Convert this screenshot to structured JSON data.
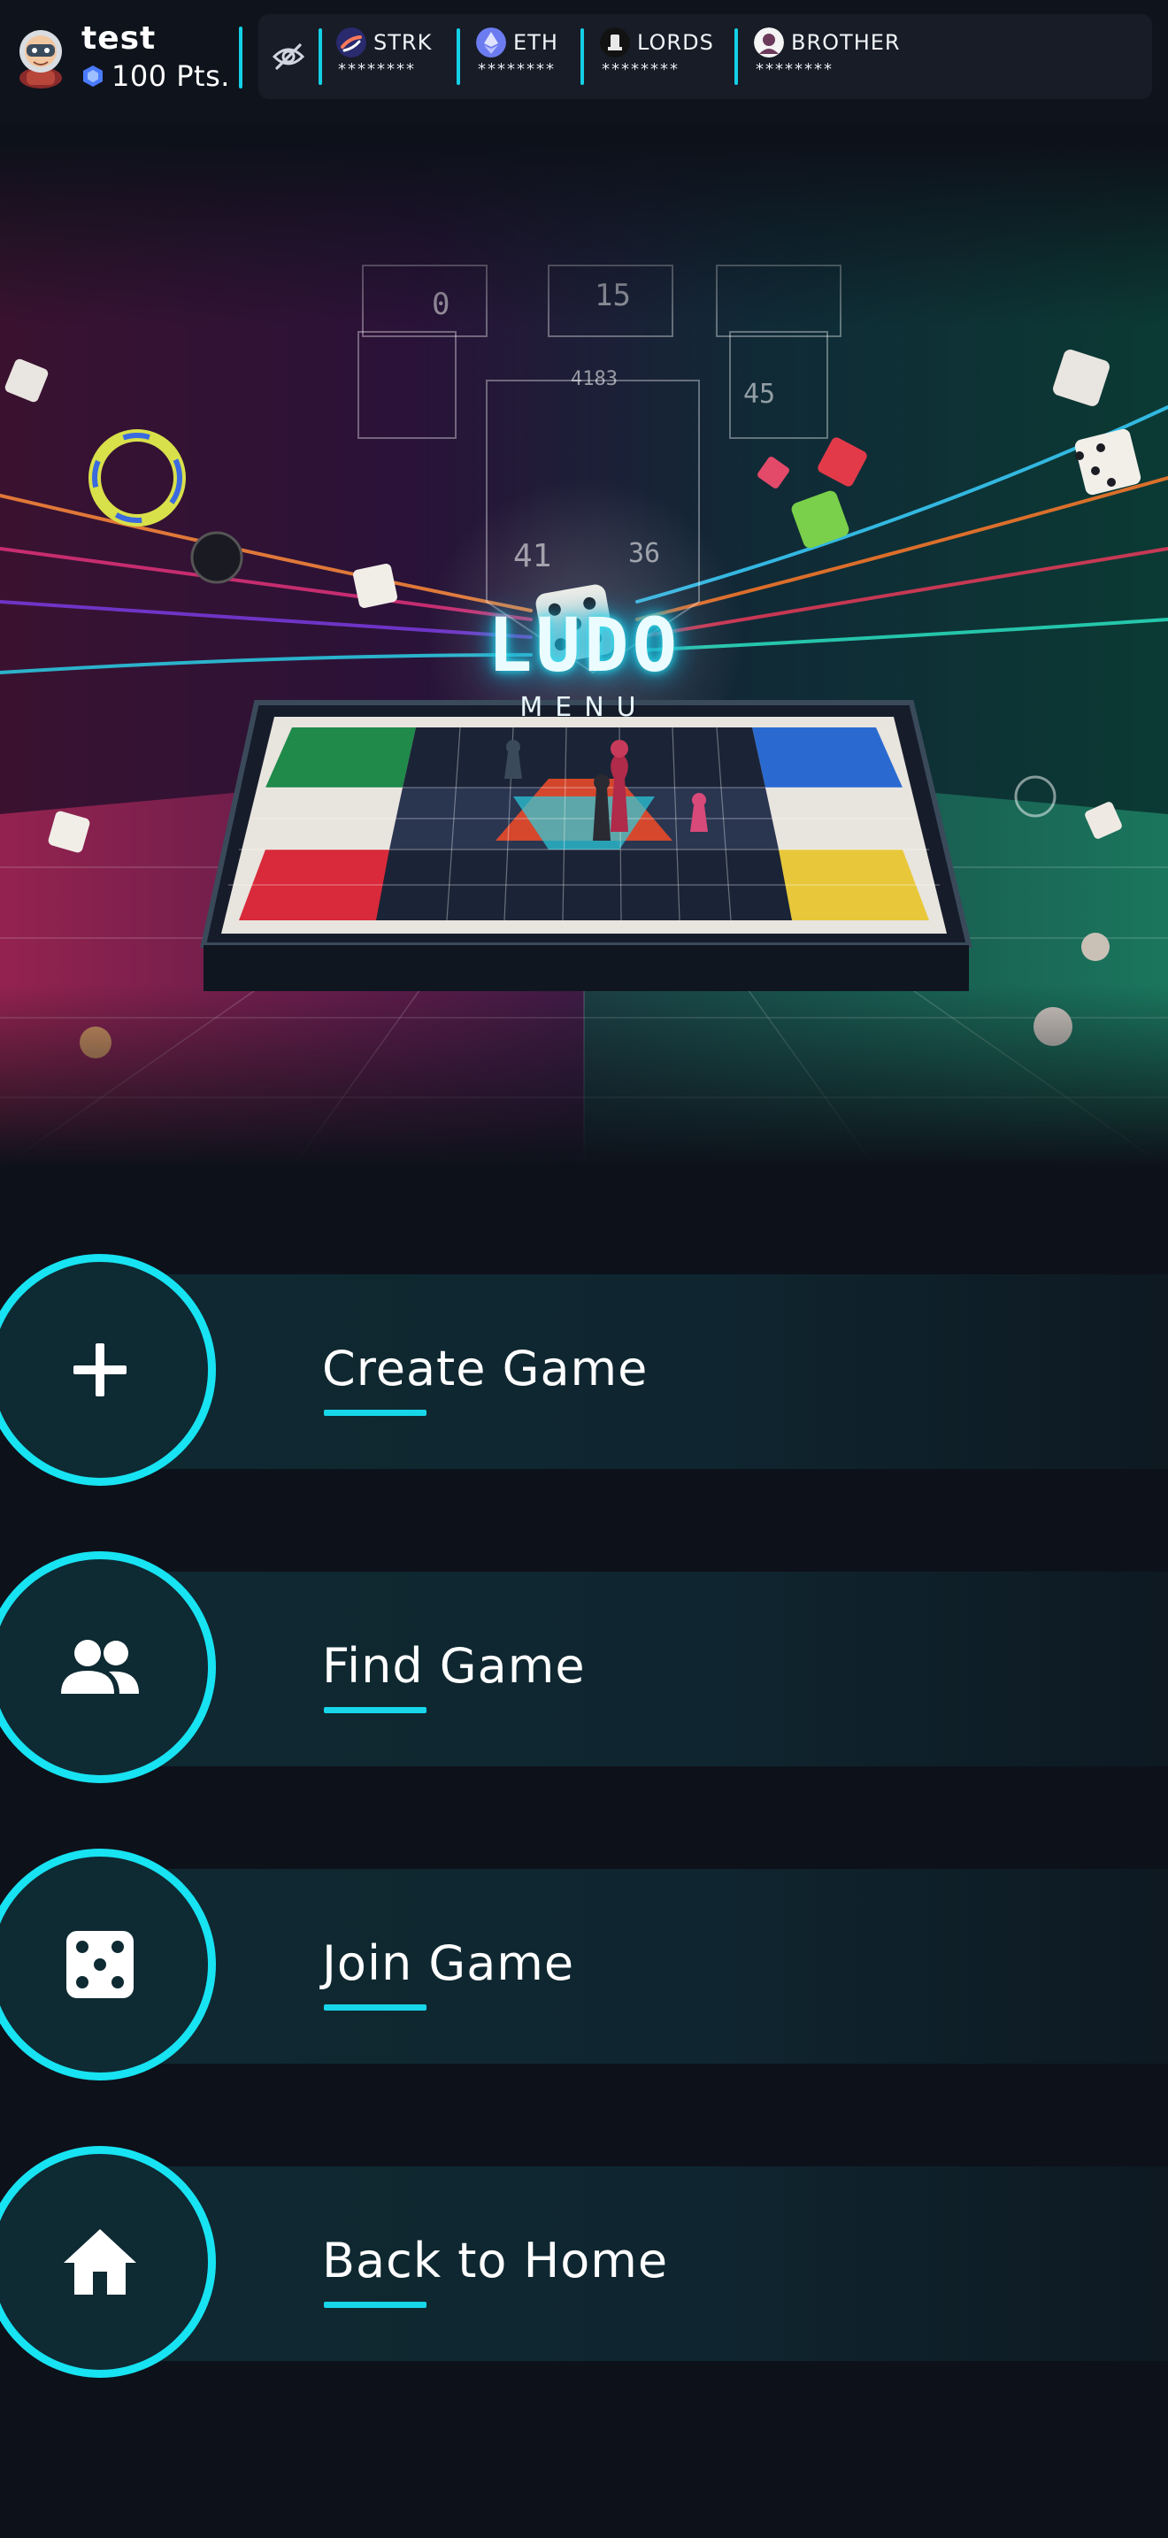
{
  "user": {
    "name": "test",
    "points": "100 Pts."
  },
  "wallet": {
    "visibility_icon": "eye-off-icon",
    "tokens": [
      {
        "name": "STRK",
        "balance": "********",
        "icon": "strk-icon",
        "color": "#5b3fd6"
      },
      {
        "name": "ETH",
        "balance": "********",
        "icon": "eth-icon",
        "color": "#6c7cf0"
      },
      {
        "name": "LORDS",
        "balance": "********",
        "icon": "lords-icon",
        "color": "#1b1b1b"
      },
      {
        "name": "BROTHER",
        "balance": "********",
        "icon": "brother-icon",
        "color": "#f2f2f2"
      }
    ]
  },
  "hero": {
    "title": "LUDO",
    "subtitle": "MENU"
  },
  "menu": {
    "items": [
      {
        "label": "Create Game",
        "icon": "plus-icon"
      },
      {
        "label": "Find Game",
        "icon": "people-icon"
      },
      {
        "label": "Join Game",
        "icon": "dice-icon"
      },
      {
        "label": "Back to Home",
        "icon": "home-icon"
      }
    ]
  },
  "colors": {
    "accent": "#17e3f2",
    "background": "#0d111a",
    "menu_bar": "#0f2931"
  }
}
